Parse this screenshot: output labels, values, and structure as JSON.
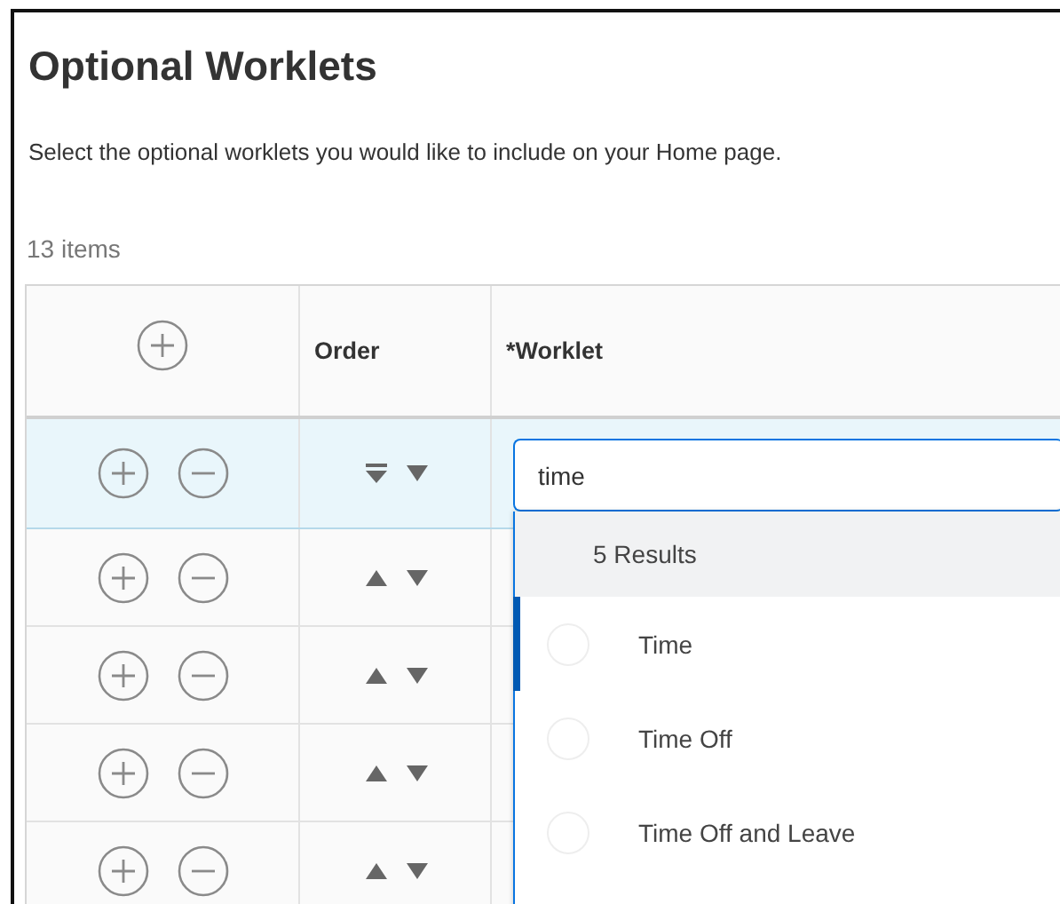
{
  "title": "Optional Worklets",
  "description": "Select the optional worklets you would like to include on your Home page.",
  "item_count": "13 items",
  "table": {
    "columns": [
      "Order",
      "*Worklet"
    ],
    "rows": [
      {
        "selected": true,
        "kind": "top"
      },
      {
        "selected": false,
        "kind": "up"
      },
      {
        "selected": false,
        "kind": "up"
      },
      {
        "selected": false,
        "kind": "up"
      },
      {
        "selected": false,
        "kind": "up"
      }
    ]
  },
  "search": {
    "value": "time",
    "results_count": "5 Results",
    "results": [
      {
        "label": "Time",
        "highlighted": true,
        "checked": false
      },
      {
        "label": "Time Off",
        "highlighted": false,
        "checked": false
      },
      {
        "label": "Time Off and Leave",
        "highlighted": false,
        "checked": false
      }
    ]
  }
}
